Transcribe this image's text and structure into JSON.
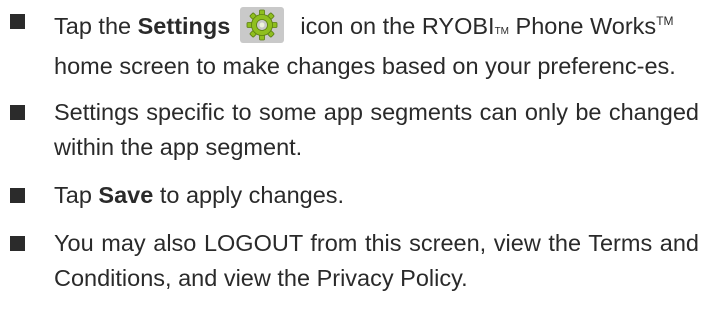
{
  "bullets": {
    "item1": {
      "prefix": "Tap the ",
      "bold": "Settings",
      "icon": "settings-gear-icon",
      "after_icon": "icon on the RYOBI",
      "tm_small": "TM",
      "product": " Phone Works",
      "tm_sup": "TM",
      "rest": "home screen to make changes based on your preferenc-es."
    },
    "item2": {
      "text": "Settings specific to some app segments can only be changed within the app segment."
    },
    "item3": {
      "prefix": "Tap ",
      "bold": "Save",
      "suffix": " to apply changes."
    },
    "item4": {
      "text": "You may also LOGOUT from this screen, view the Terms and Conditions, and view the Privacy Policy."
    }
  },
  "colors": {
    "text": "#2a2a2a",
    "bullet": "#2b2b2b",
    "icon_box": "#c9c9c9",
    "gear": "#8fbf1f"
  }
}
